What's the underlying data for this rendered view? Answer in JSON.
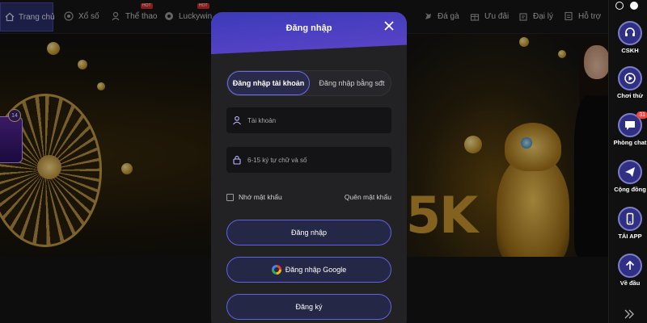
{
  "nav": {
    "items": [
      {
        "label": "Trang chủ",
        "icon": "home-icon",
        "active": true
      },
      {
        "label": "Xổ số",
        "icon": "lottery-icon"
      },
      {
        "label": "Thể thao",
        "icon": "sports-icon",
        "hot": "HOT"
      },
      {
        "label": "Luckywin",
        "icon": "luckywin-icon",
        "hot": "HOT"
      },
      {
        "label": "Đá gà",
        "icon": "cockfight-icon"
      },
      {
        "label": "Ưu đãi",
        "icon": "gift-icon"
      },
      {
        "label": "Đại lý",
        "icon": "agent-icon"
      },
      {
        "label": "Hỗ trợ",
        "icon": "support-icon"
      }
    ]
  },
  "banner": {
    "badge_number": "14",
    "promo_text": "5K"
  },
  "sidebar": {
    "items": [
      {
        "label": "CSKH",
        "icon": "customer-service-icon"
      },
      {
        "label": "Chơi thử",
        "icon": "play-demo-icon"
      },
      {
        "label": "Phòng chat",
        "icon": "chat-icon",
        "count": "31"
      },
      {
        "label": "Cộng đồng",
        "icon": "telegram-icon"
      },
      {
        "label": "TẢI APP",
        "icon": "download-app-icon"
      },
      {
        "label": "Về đầu",
        "icon": "back-to-top-icon"
      }
    ]
  },
  "modal": {
    "title": "Đăng nhập",
    "tabs": {
      "account": "Đăng nhập tài khoản",
      "phone": "Đăng nhập bằng sđt"
    },
    "username_placeholder": "Tài khoản",
    "password_placeholder": "6-15 ký tự chữ và số",
    "remember_label": "Nhớ mật khẩu",
    "forgot_label": "Quên mật khẩu",
    "login_button": "Đăng nhập",
    "google_button": "Đăng nhập Google",
    "register_button": "Đăng ký"
  },
  "colors": {
    "accent": "#5f63e0",
    "header_gradient_start": "#3a3bb8",
    "header_gradient_end": "#5e44c9",
    "modal_bg": "#222225",
    "sidebar_icon_bg": "#2f3083"
  }
}
